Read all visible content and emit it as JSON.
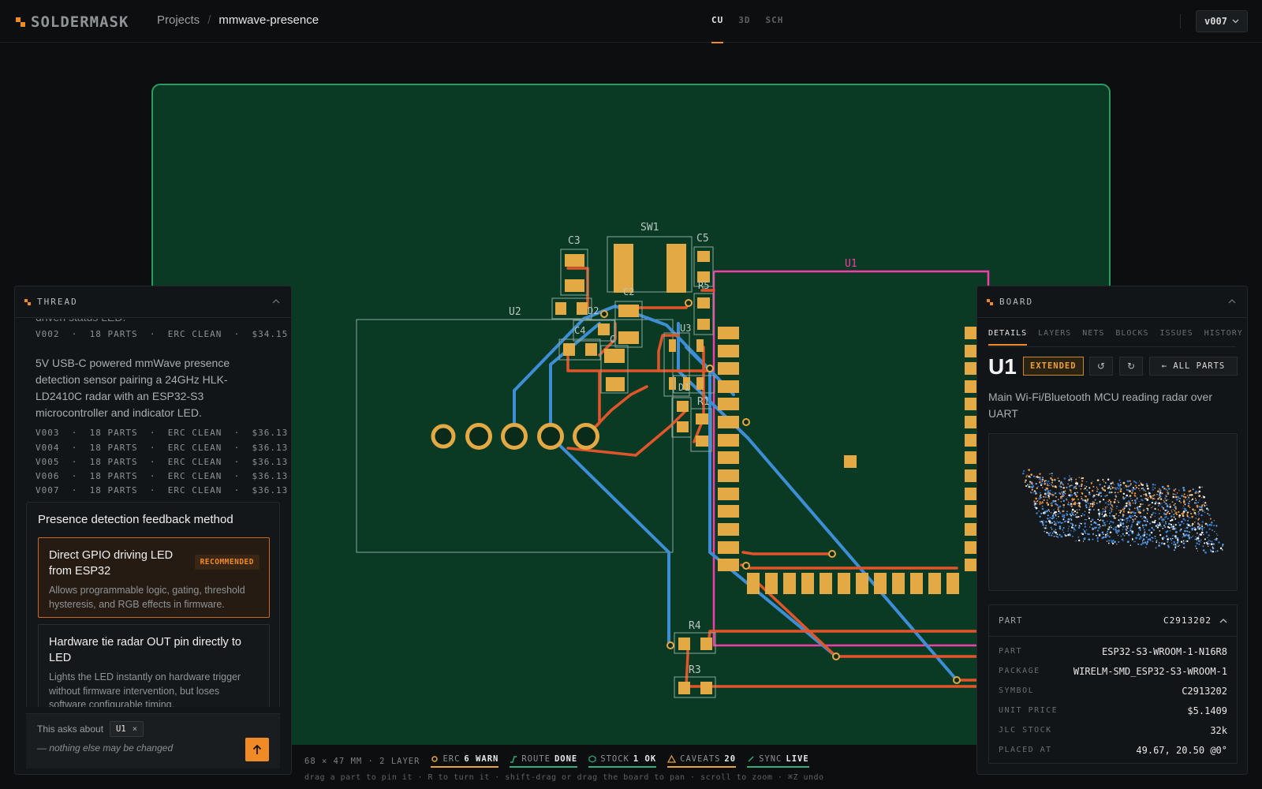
{
  "app": {
    "logo_text": "SOLDERMASK",
    "crumb_projects": "Projects",
    "crumb_sep": "/",
    "project_name": "mmwave-presence",
    "view_tabs": [
      "CU",
      "3D",
      "SCH"
    ],
    "active_view": "CU",
    "version": "v007",
    "accent": "#f08a24"
  },
  "pcb": {
    "board_fill": "#0a3a24",
    "board_outline": "#2e9a62",
    "pad_color": "#e3a944",
    "silk_color": "#b8c8c0",
    "top_trace": "#e0562a",
    "bottom_trace": "#3d8ed6",
    "highlight": "#f23fa8",
    "labels": {
      "SW1": "SW1",
      "C3": "C3",
      "C5": "C5",
      "U1": "U1",
      "U2": "U2",
      "D2": "D2",
      "C2": "C2",
      "R5": "R5",
      "C4": "C4",
      "C1": "C",
      "U3": "U3",
      "D1": "D1",
      "R1": "R1",
      "R2": "R2",
      "R4": "R4",
      "R3": "R3"
    }
  },
  "thread": {
    "title": "THREAD",
    "clipped_text": "driven status LED.",
    "v002": [
      "V002",
      "18 PARTS",
      "ERC CLEAN",
      "$34.15"
    ],
    "description": "5V USB-C powered mmWave presence detection sensor pairing a 24GHz HLK-LD2410C radar with an ESP32-S3 microcontroller and indicator LED.",
    "versions": [
      [
        "V003",
        "18 PARTS",
        "ERC CLEAN",
        "$36.13"
      ],
      [
        "V004",
        "18 PARTS",
        "ERC CLEAN",
        "$36.13"
      ],
      [
        "V005",
        "18 PARTS",
        "ERC CLEAN",
        "$36.13"
      ],
      [
        "V006",
        "18 PARTS",
        "ERC CLEAN",
        "$36.13"
      ],
      [
        "V007",
        "18 PARTS",
        "ERC CLEAN",
        "$36.13"
      ]
    ],
    "question": {
      "title": "Presence detection feedback method",
      "options": [
        {
          "title": "Direct GPIO driving LED from ESP32",
          "badge": "RECOMMENDED",
          "desc": "Allows programmable logic, gating, threshold hysteresis, and RGB effects in firmware."
        },
        {
          "title": "Hardware tie radar OUT pin directly to LED",
          "desc": "Lights the LED instantly on hardware trigger without firmware intervention, but loses software configurable timing."
        }
      ]
    },
    "composer": {
      "asks_label": "This asks about",
      "chip": "U1",
      "chip_close": "×",
      "placeholder": "— nothing else may be changed"
    }
  },
  "board_panel": {
    "title": "BOARD",
    "tabs": [
      "DETAILS",
      "LAYERS",
      "NETS",
      "BLOCKS",
      "ISSUES",
      "HISTORY"
    ],
    "active_tab": "DETAILS",
    "ref": "U1",
    "badge": "EXTENDED",
    "undo": "↺",
    "redo": "↻",
    "all_parts": "← ALL PARTS",
    "description": "Main Wi-Fi/Bluetooth MCU reading radar over UART",
    "part_header": "PART",
    "part_header_value": "C2913202",
    "specs": [
      {
        "k": "PART",
        "v": "ESP32-S3-WROOM-1-N16R8"
      },
      {
        "k": "PACKAGE",
        "v": "WIRELM-SMD_ESP32-S3-WROOM-1"
      },
      {
        "k": "SYMBOL",
        "v": "C2913202"
      },
      {
        "k": "UNIT PRICE",
        "v": "$5.1409"
      },
      {
        "k": "JLC STOCK",
        "v": "32k"
      },
      {
        "k": "PLACED AT",
        "v": "49.67, 20.50 @0°"
      }
    ]
  },
  "status": {
    "dims": "68 × 47 MM · 2 LAYER",
    "items": [
      {
        "label": "ERC",
        "value": "6 WARN",
        "color": "#e8a23a"
      },
      {
        "label": "ROUTE",
        "value": "DONE",
        "color": "#2fb07a"
      },
      {
        "label": "STOCK",
        "value": "1 OK",
        "color": "#2fb07a"
      },
      {
        "label": "CAVEATS",
        "value": "20",
        "color": "#e8a23a"
      },
      {
        "label": "SYNC",
        "value": "LIVE",
        "color": "#2fb07a"
      }
    ],
    "hint": "drag a part to pin it · R to turn it · shift-drag or drag the board to pan · scroll to zoom · ⌘Z undo"
  }
}
